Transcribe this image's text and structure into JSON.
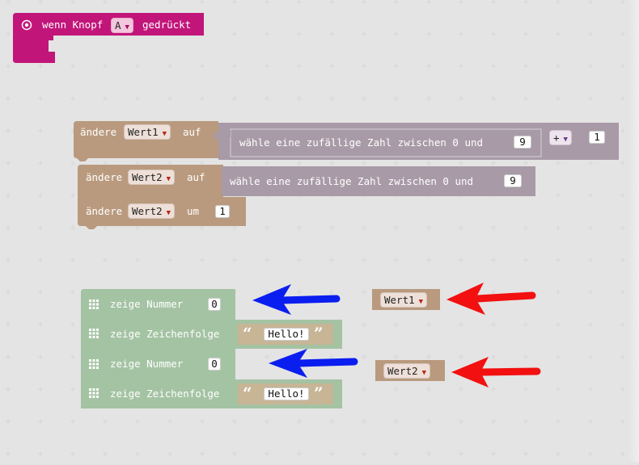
{
  "event_block": {
    "prefix": "wenn Knopf",
    "button_value": "A",
    "suffix": "gedrückt"
  },
  "set_block_1": {
    "label": "ändere",
    "variable": "Wert1",
    "keyword": "auf",
    "random_text": "wähle eine zufällige Zahl zwischen 0 und",
    "random_max": "9",
    "operator": "+",
    "operand": "1"
  },
  "set_block_2": {
    "label": "ändere",
    "variable": "Wert2",
    "keyword": "auf",
    "random_text": "wähle eine zufällige Zahl zwischen 0 und",
    "random_max": "9"
  },
  "change_block": {
    "label": "ändere",
    "variable": "Wert2",
    "keyword": "um",
    "value": "1"
  },
  "show_blocks": [
    {
      "label": "zeige Nummer",
      "value": "0"
    },
    {
      "label": "zeige Zeichenfolge",
      "value": "Hello!"
    },
    {
      "label": "zeige Nummer",
      "value": "0"
    },
    {
      "label": "zeige Zeichenfolge",
      "value": "Hello!"
    }
  ],
  "variable_blocks": [
    {
      "name": "Wert1"
    },
    {
      "name": "Wert2"
    }
  ],
  "colors": {
    "event": "#c2157a",
    "variables": "#b99a7e",
    "math": "#a89aa6",
    "basic": "#a4c3a3",
    "arrow_blue": "#0a1ef0",
    "arrow_red": "#f21010"
  },
  "quote_open": "“",
  "quote_close": "”"
}
